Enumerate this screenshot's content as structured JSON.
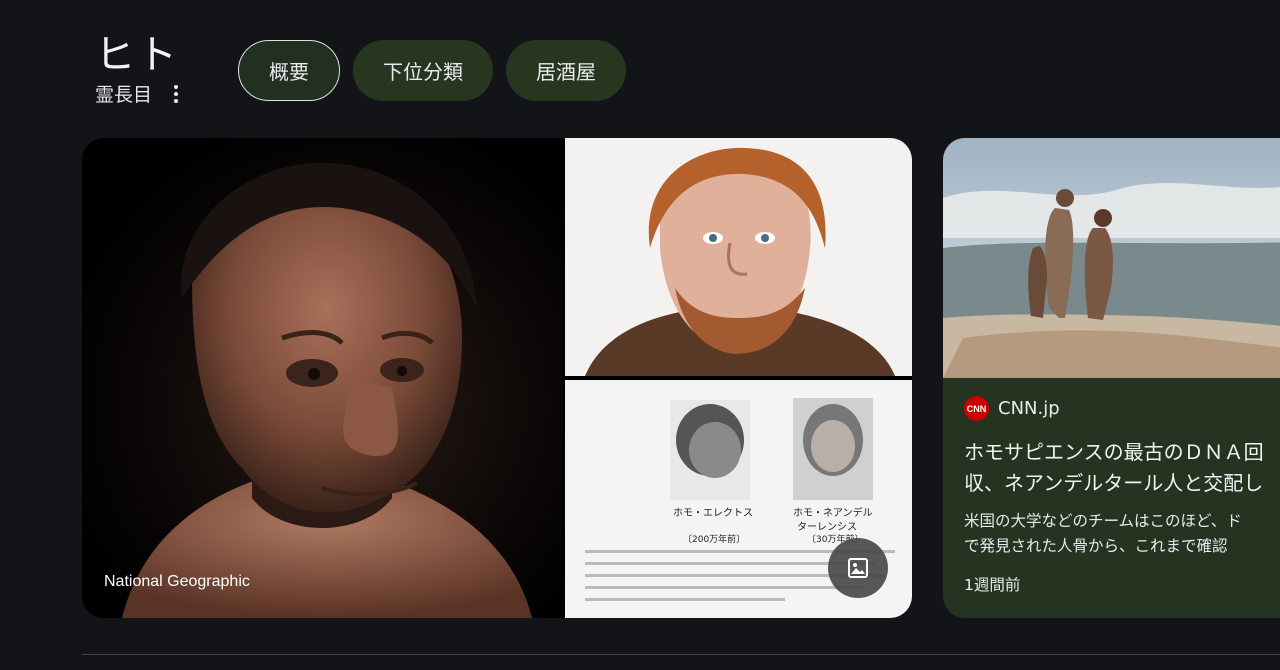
{
  "header": {
    "title": "ヒト",
    "subtitle": "霊長目"
  },
  "chips": [
    {
      "label": "概要",
      "active": true
    },
    {
      "label": "下位分類",
      "active": false
    },
    {
      "label": "居酒屋",
      "active": false
    }
  ],
  "gallery": {
    "main_source": "National Geographic",
    "lower_right": {
      "left_caption": "ホモ・エレクトス",
      "left_era": "〔200万年前〕",
      "right_caption_1": "ホモ・ネアンデル",
      "right_caption_2": "ターレンシス",
      "right_era": "〔30万年前〕"
    }
  },
  "news_card": {
    "source": "CNN.jp",
    "logo_text": "CNN",
    "headline_line1": "ホモサピエンスの最古のＤＮＡ回",
    "headline_line2": "収、ネアンデルタール人と交配し",
    "snippet_line1": "米国の大学などのチームはこのほど、ド",
    "snippet_line2": "で発見された人骨から、これまで確認",
    "time": "1週間前"
  },
  "colors": {
    "background": "#131418",
    "chip": "#26361f",
    "card": "#253321",
    "cnn_red": "#cc0000"
  }
}
